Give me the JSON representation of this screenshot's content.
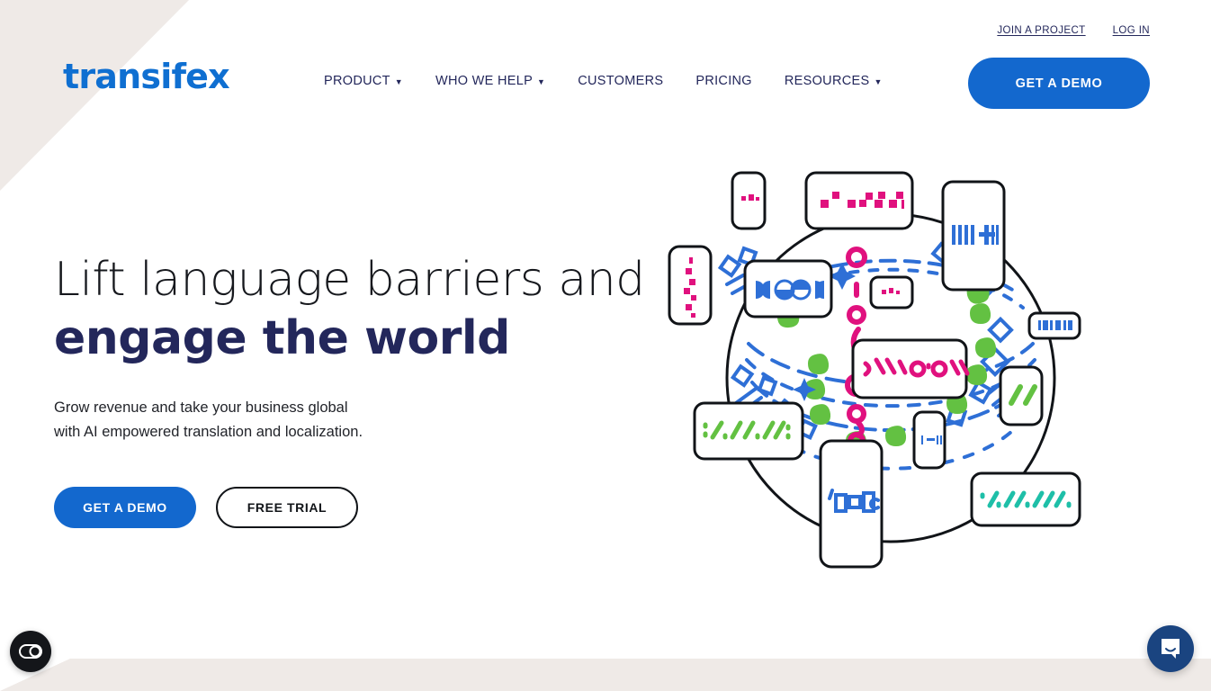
{
  "brand": {
    "logo_text": "transifex",
    "logo_color": "#0F6FD1",
    "accent_blue": "#1368CE",
    "navy": "#23275B",
    "beige": "#EFEAE7"
  },
  "topbar": {
    "links": [
      {
        "label": "JOIN A PROJECT",
        "name": "join-a-project-link"
      },
      {
        "label": "LOG IN",
        "name": "log-in-link"
      }
    ]
  },
  "nav": {
    "items": [
      {
        "label": "PRODUCT",
        "has_dropdown": true,
        "caret": "▼"
      },
      {
        "label": "WHO WE HELP",
        "has_dropdown": true,
        "caret": "▼"
      },
      {
        "label": "CUSTOMERS",
        "has_dropdown": false,
        "caret": ""
      },
      {
        "label": "PRICING",
        "has_dropdown": false,
        "caret": ""
      },
      {
        "label": "RESOURCES",
        "has_dropdown": true,
        "caret": "▼"
      }
    ],
    "cta_label": "GET A DEMO"
  },
  "hero": {
    "headline_line1": "Lift language barriers and",
    "headline_line2": "engage the world",
    "subhead_line1": "Grow revenue and take your business global",
    "subhead_line2": "with AI empowered translation and localization.",
    "primary_button": "GET A DEMO",
    "secondary_button": "FREE TRIAL"
  },
  "illustration": {
    "name": "global-languages-illustration",
    "description": "Globe of dashed blue latitude lines surrounded by white rounded cards containing abstract multilingual script glyphs",
    "glyph_colors": {
      "magenta": "#E0117E",
      "blue": "#2E6FD6",
      "green": "#63C142",
      "teal": "#1EBFA8",
      "outline": "#111418"
    }
  },
  "widgets": {
    "accessibility": {
      "icon": "accessibility-toggle-icon",
      "label": "Accessibility options"
    },
    "chat": {
      "icon": "chat-bubble-icon",
      "label": "Open chat"
    }
  }
}
